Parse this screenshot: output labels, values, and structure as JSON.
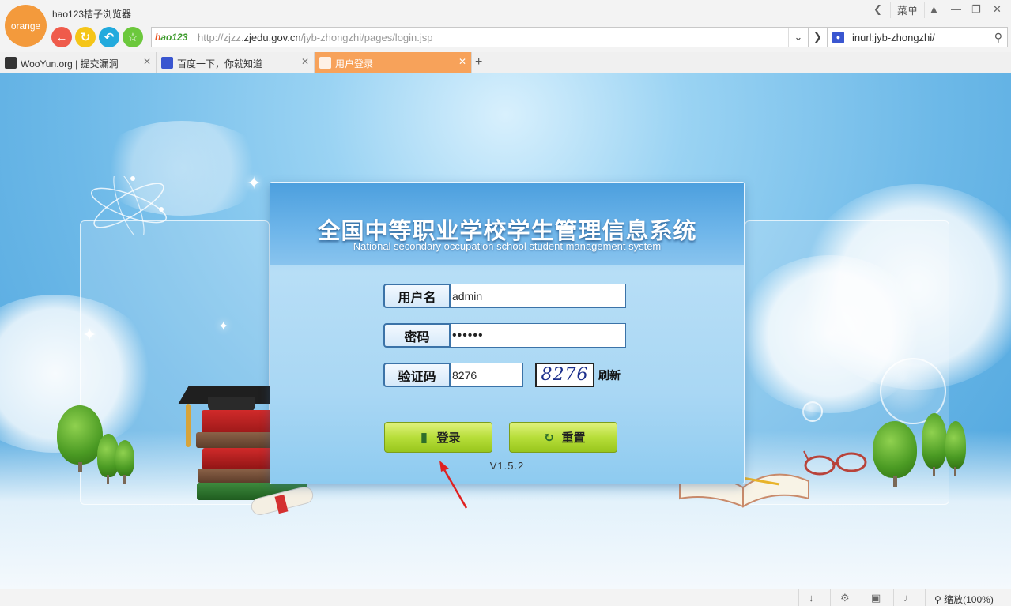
{
  "browser": {
    "logo_text": "orange",
    "app_title": "hao123桔子浏览器",
    "menu_label": "菜单",
    "address": {
      "brand": "hao123",
      "url_prefix": "http://zjzz.",
      "url_domain": "zjedu.gov.cn",
      "url_path": "/jyb-zhongzhi/pages/login.jsp"
    },
    "search": {
      "query": "inurl:jyb-zhongzhi/"
    },
    "tabs": [
      {
        "label": "WooYun.org | 提交漏洞",
        "active": false
      },
      {
        "label": "百度一下，你就知道",
        "active": false
      },
      {
        "label": "用户登录",
        "active": true
      }
    ],
    "status": {
      "zoom": "缩放(100%)"
    }
  },
  "login": {
    "title": "全国中等职业学校学生管理信息系统",
    "subtitle": "National secondary occupation school student management system",
    "username_label": "用户名",
    "username_value": "admin",
    "password_label": "密码",
    "password_value": "••••••",
    "captcha_label": "验证码",
    "captcha_value": "8276",
    "captcha_image_text": "8276",
    "refresh_label": "刷新",
    "login_button": "登录",
    "reset_button": "重置",
    "version": "V1.5.2"
  },
  "colors": {
    "orange_accent": "#f7a25a",
    "button_green": "#b7de3a",
    "field_border": "#3b73a8",
    "annotation_arrow": "#e02020"
  }
}
